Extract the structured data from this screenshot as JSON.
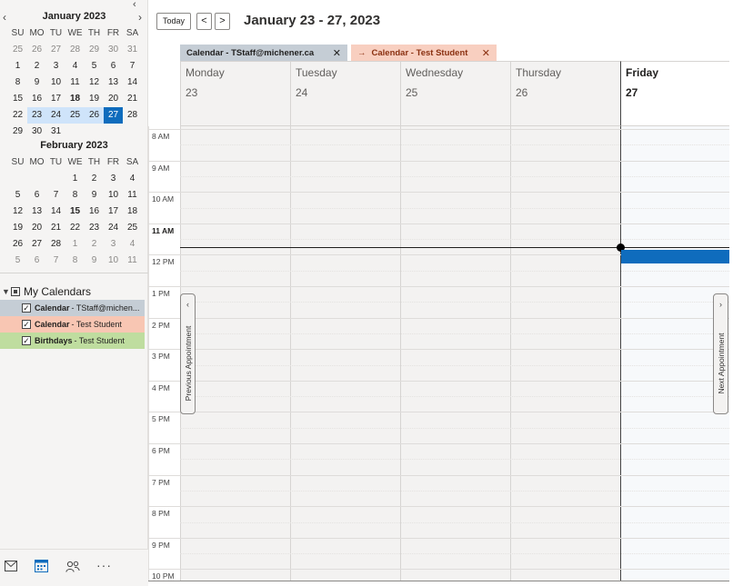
{
  "mini_calendars": [
    {
      "title": "January 2023",
      "dow": [
        "SU",
        "MO",
        "TU",
        "WE",
        "TH",
        "FR",
        "SA"
      ],
      "weeks": [
        [
          {
            "d": "25",
            "o": true
          },
          {
            "d": "26",
            "o": true
          },
          {
            "d": "27",
            "o": true
          },
          {
            "d": "28",
            "o": true
          },
          {
            "d": "29",
            "o": true
          },
          {
            "d": "30",
            "o": true
          },
          {
            "d": "31",
            "o": true
          }
        ],
        [
          {
            "d": "1"
          },
          {
            "d": "2"
          },
          {
            "d": "3"
          },
          {
            "d": "4"
          },
          {
            "d": "5"
          },
          {
            "d": "6"
          },
          {
            "d": "7"
          }
        ],
        [
          {
            "d": "8"
          },
          {
            "d": "9"
          },
          {
            "d": "10"
          },
          {
            "d": "11"
          },
          {
            "d": "12"
          },
          {
            "d": "13"
          },
          {
            "d": "14"
          }
        ],
        [
          {
            "d": "15"
          },
          {
            "d": "16"
          },
          {
            "d": "17"
          },
          {
            "d": "18",
            "b": true
          },
          {
            "d": "19"
          },
          {
            "d": "20"
          },
          {
            "d": "21"
          }
        ],
        [
          {
            "d": "22"
          },
          {
            "d": "23",
            "w": true
          },
          {
            "d": "24",
            "w": true
          },
          {
            "d": "25",
            "w": true
          },
          {
            "d": "26",
            "w": true
          },
          {
            "d": "27",
            "sel": true
          },
          {
            "d": "28"
          }
        ],
        [
          {
            "d": "29"
          },
          {
            "d": "30"
          },
          {
            "d": "31"
          }
        ]
      ]
    },
    {
      "title": "February 2023",
      "dow": [
        "SU",
        "MO",
        "TU",
        "WE",
        "TH",
        "FR",
        "SA"
      ],
      "weeks": [
        [
          {
            "d": ""
          },
          {
            "d": ""
          },
          {
            "d": ""
          },
          {
            "d": "1"
          },
          {
            "d": "2"
          },
          {
            "d": "3"
          },
          {
            "d": "4"
          }
        ],
        [
          {
            "d": "5"
          },
          {
            "d": "6"
          },
          {
            "d": "7"
          },
          {
            "d": "8"
          },
          {
            "d": "9"
          },
          {
            "d": "10"
          },
          {
            "d": "11"
          }
        ],
        [
          {
            "d": "12"
          },
          {
            "d": "13"
          },
          {
            "d": "14"
          },
          {
            "d": "15",
            "b": true
          },
          {
            "d": "16"
          },
          {
            "d": "17"
          },
          {
            "d": "18"
          }
        ],
        [
          {
            "d": "19"
          },
          {
            "d": "20"
          },
          {
            "d": "21"
          },
          {
            "d": "22"
          },
          {
            "d": "23"
          },
          {
            "d": "24"
          },
          {
            "d": "25"
          }
        ],
        [
          {
            "d": "26"
          },
          {
            "d": "27"
          },
          {
            "d": "28"
          },
          {
            "d": "1",
            "o": true
          },
          {
            "d": "2",
            "o": true
          },
          {
            "d": "3",
            "o": true
          },
          {
            "d": "4",
            "o": true
          }
        ],
        [
          {
            "d": "5",
            "o": true
          },
          {
            "d": "6",
            "o": true
          },
          {
            "d": "7",
            "o": true
          },
          {
            "d": "8",
            "o": true
          },
          {
            "d": "9",
            "o": true
          },
          {
            "d": "10",
            "o": true
          },
          {
            "d": "11",
            "o": true
          }
        ]
      ]
    }
  ],
  "my_calendars": {
    "title": "My Calendars",
    "items": [
      {
        "name": "Calendar",
        "owner": "- TStaff@michen...",
        "color": "#c5cdd5",
        "checked": true
      },
      {
        "name": "Calendar",
        "owner": "- Test Student",
        "color": "#f8c6b3",
        "checked": true
      },
      {
        "name": "Birthdays",
        "owner": "- Test Student",
        "color": "#bfdd9f",
        "checked": true
      }
    ]
  },
  "bottom_nav": [
    "mail-icon",
    "calendar-icon",
    "people-icon",
    "more-icon"
  ],
  "toolbar": {
    "today_label": "Today",
    "prev": "<",
    "next": ">",
    "range_title": "January 23 - 27, 2023"
  },
  "tabs": [
    {
      "label": "Calendar - TStaff@michener.ca",
      "close": "✕"
    },
    {
      "label": "Calendar - Test Student",
      "close": "✕",
      "arrow": "→"
    }
  ],
  "days": [
    {
      "name": "Monday",
      "date": "23",
      "today": false
    },
    {
      "name": "Tuesday",
      "date": "24",
      "today": false
    },
    {
      "name": "Wednesday",
      "date": "25",
      "today": false
    },
    {
      "name": "Thursday",
      "date": "26",
      "today": false
    },
    {
      "name": "Friday",
      "date": "27",
      "today": true
    }
  ],
  "time_labels": [
    "8 AM",
    "9 AM",
    "10 AM",
    "11 AM",
    "12 PM",
    "1 PM",
    "2 PM",
    "3 PM",
    "4 PM",
    "5 PM",
    "6 PM",
    "7 PM",
    "8 PM",
    "9 PM",
    "10 PM"
  ],
  "current_hour_label": "11 AM",
  "peek": {
    "previous_label": "Previous Appointment",
    "previous_chevron": "‹",
    "next_label": "Next Appointment",
    "next_chevron": "›"
  },
  "colors": {
    "accent": "#0f6cbd",
    "week_highlight": "#cfe4fa"
  }
}
